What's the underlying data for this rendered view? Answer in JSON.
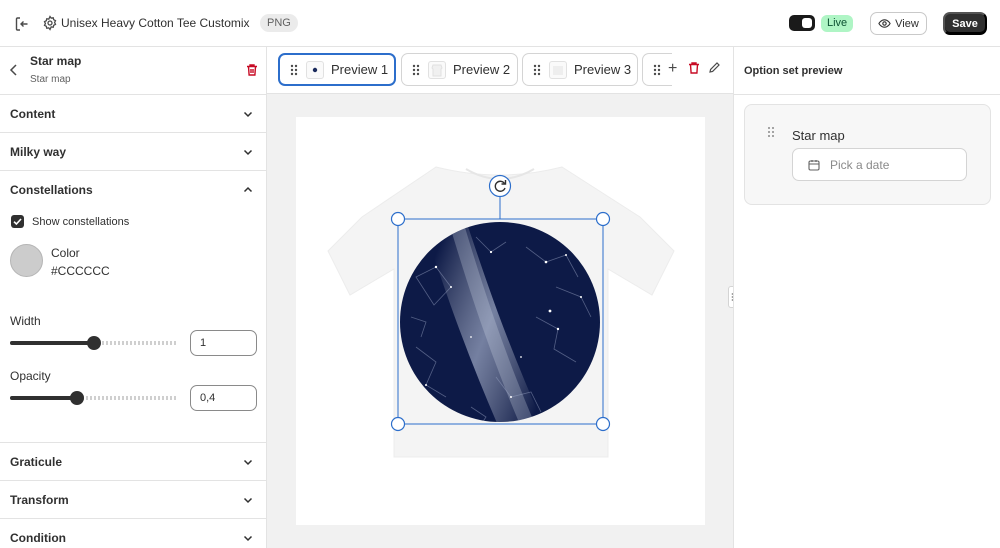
{
  "header": {
    "product_title": "Unisex Heavy Cotton Tee Customix",
    "file_badge": "PNG",
    "live_label": "Live",
    "view_label": "View",
    "save_label": "Save"
  },
  "editor": {
    "title": "Star map",
    "subtitle": "Star map",
    "sections": {
      "content": "Content",
      "milky_way": "Milky way",
      "constellations": "Constellations",
      "graticule": "Graticule",
      "transform": "Transform",
      "condition": "Condition"
    },
    "constellations": {
      "show_label": "Show constellations",
      "show_checked": true,
      "color_label": "Color",
      "color_value": "#CCCCCC",
      "width_label": "Width",
      "width_value": "1",
      "width_slider_fraction": 0.5,
      "opacity_label": "Opacity",
      "opacity_value": "0,4",
      "opacity_slider_fraction": 0.4
    }
  },
  "previews": {
    "tabs": [
      {
        "label": "Preview 1",
        "active": true
      },
      {
        "label": "Preview 2",
        "active": false
      },
      {
        "label": "Preview 3",
        "active": false
      }
    ]
  },
  "option_set_preview": {
    "title": "Option set preview",
    "field_label": "Star map",
    "date_placeholder": "Pick a date"
  },
  "colors": {
    "accent": "#2c6ecb",
    "live_badge_bg": "#aff5c5",
    "danger": "#c70a24",
    "star_map_bg": "#0d1a47",
    "constellation_line": "#CCCCCC"
  },
  "icons": {
    "exit": "exit-icon",
    "settings": "gear-icon",
    "view": "eye-icon",
    "back": "chevron-left-icon",
    "delete": "trash-icon",
    "collapse": "chevron-down-icon",
    "expand": "chevron-up-icon",
    "drag": "drag-handle-icon",
    "add": "plus-icon",
    "edit": "pencil-icon",
    "rotate": "rotate-icon",
    "calendar": "calendar-icon"
  }
}
